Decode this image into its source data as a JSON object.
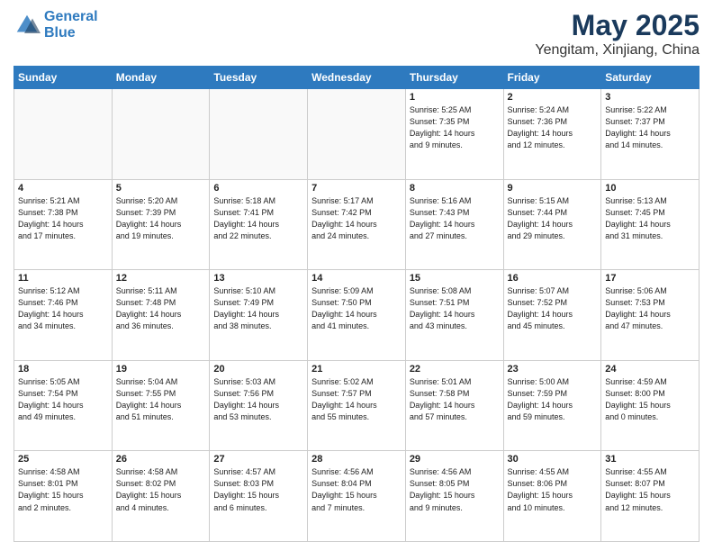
{
  "header": {
    "logo_line1": "General",
    "logo_line2": "Blue",
    "month": "May 2025",
    "location": "Yengitam, Xinjiang, China"
  },
  "days_of_week": [
    "Sunday",
    "Monday",
    "Tuesday",
    "Wednesday",
    "Thursday",
    "Friday",
    "Saturday"
  ],
  "weeks": [
    [
      {
        "num": "",
        "info": ""
      },
      {
        "num": "",
        "info": ""
      },
      {
        "num": "",
        "info": ""
      },
      {
        "num": "",
        "info": ""
      },
      {
        "num": "1",
        "info": "Sunrise: 5:25 AM\nSunset: 7:35 PM\nDaylight: 14 hours\nand 9 minutes."
      },
      {
        "num": "2",
        "info": "Sunrise: 5:24 AM\nSunset: 7:36 PM\nDaylight: 14 hours\nand 12 minutes."
      },
      {
        "num": "3",
        "info": "Sunrise: 5:22 AM\nSunset: 7:37 PM\nDaylight: 14 hours\nand 14 minutes."
      }
    ],
    [
      {
        "num": "4",
        "info": "Sunrise: 5:21 AM\nSunset: 7:38 PM\nDaylight: 14 hours\nand 17 minutes."
      },
      {
        "num": "5",
        "info": "Sunrise: 5:20 AM\nSunset: 7:39 PM\nDaylight: 14 hours\nand 19 minutes."
      },
      {
        "num": "6",
        "info": "Sunrise: 5:18 AM\nSunset: 7:41 PM\nDaylight: 14 hours\nand 22 minutes."
      },
      {
        "num": "7",
        "info": "Sunrise: 5:17 AM\nSunset: 7:42 PM\nDaylight: 14 hours\nand 24 minutes."
      },
      {
        "num": "8",
        "info": "Sunrise: 5:16 AM\nSunset: 7:43 PM\nDaylight: 14 hours\nand 27 minutes."
      },
      {
        "num": "9",
        "info": "Sunrise: 5:15 AM\nSunset: 7:44 PM\nDaylight: 14 hours\nand 29 minutes."
      },
      {
        "num": "10",
        "info": "Sunrise: 5:13 AM\nSunset: 7:45 PM\nDaylight: 14 hours\nand 31 minutes."
      }
    ],
    [
      {
        "num": "11",
        "info": "Sunrise: 5:12 AM\nSunset: 7:46 PM\nDaylight: 14 hours\nand 34 minutes."
      },
      {
        "num": "12",
        "info": "Sunrise: 5:11 AM\nSunset: 7:48 PM\nDaylight: 14 hours\nand 36 minutes."
      },
      {
        "num": "13",
        "info": "Sunrise: 5:10 AM\nSunset: 7:49 PM\nDaylight: 14 hours\nand 38 minutes."
      },
      {
        "num": "14",
        "info": "Sunrise: 5:09 AM\nSunset: 7:50 PM\nDaylight: 14 hours\nand 41 minutes."
      },
      {
        "num": "15",
        "info": "Sunrise: 5:08 AM\nSunset: 7:51 PM\nDaylight: 14 hours\nand 43 minutes."
      },
      {
        "num": "16",
        "info": "Sunrise: 5:07 AM\nSunset: 7:52 PM\nDaylight: 14 hours\nand 45 minutes."
      },
      {
        "num": "17",
        "info": "Sunrise: 5:06 AM\nSunset: 7:53 PM\nDaylight: 14 hours\nand 47 minutes."
      }
    ],
    [
      {
        "num": "18",
        "info": "Sunrise: 5:05 AM\nSunset: 7:54 PM\nDaylight: 14 hours\nand 49 minutes."
      },
      {
        "num": "19",
        "info": "Sunrise: 5:04 AM\nSunset: 7:55 PM\nDaylight: 14 hours\nand 51 minutes."
      },
      {
        "num": "20",
        "info": "Sunrise: 5:03 AM\nSunset: 7:56 PM\nDaylight: 14 hours\nand 53 minutes."
      },
      {
        "num": "21",
        "info": "Sunrise: 5:02 AM\nSunset: 7:57 PM\nDaylight: 14 hours\nand 55 minutes."
      },
      {
        "num": "22",
        "info": "Sunrise: 5:01 AM\nSunset: 7:58 PM\nDaylight: 14 hours\nand 57 minutes."
      },
      {
        "num": "23",
        "info": "Sunrise: 5:00 AM\nSunset: 7:59 PM\nDaylight: 14 hours\nand 59 minutes."
      },
      {
        "num": "24",
        "info": "Sunrise: 4:59 AM\nSunset: 8:00 PM\nDaylight: 15 hours\nand 0 minutes."
      }
    ],
    [
      {
        "num": "25",
        "info": "Sunrise: 4:58 AM\nSunset: 8:01 PM\nDaylight: 15 hours\nand 2 minutes."
      },
      {
        "num": "26",
        "info": "Sunrise: 4:58 AM\nSunset: 8:02 PM\nDaylight: 15 hours\nand 4 minutes."
      },
      {
        "num": "27",
        "info": "Sunrise: 4:57 AM\nSunset: 8:03 PM\nDaylight: 15 hours\nand 6 minutes."
      },
      {
        "num": "28",
        "info": "Sunrise: 4:56 AM\nSunset: 8:04 PM\nDaylight: 15 hours\nand 7 minutes."
      },
      {
        "num": "29",
        "info": "Sunrise: 4:56 AM\nSunset: 8:05 PM\nDaylight: 15 hours\nand 9 minutes."
      },
      {
        "num": "30",
        "info": "Sunrise: 4:55 AM\nSunset: 8:06 PM\nDaylight: 15 hours\nand 10 minutes."
      },
      {
        "num": "31",
        "info": "Sunrise: 4:55 AM\nSunset: 8:07 PM\nDaylight: 15 hours\nand 12 minutes."
      }
    ]
  ]
}
